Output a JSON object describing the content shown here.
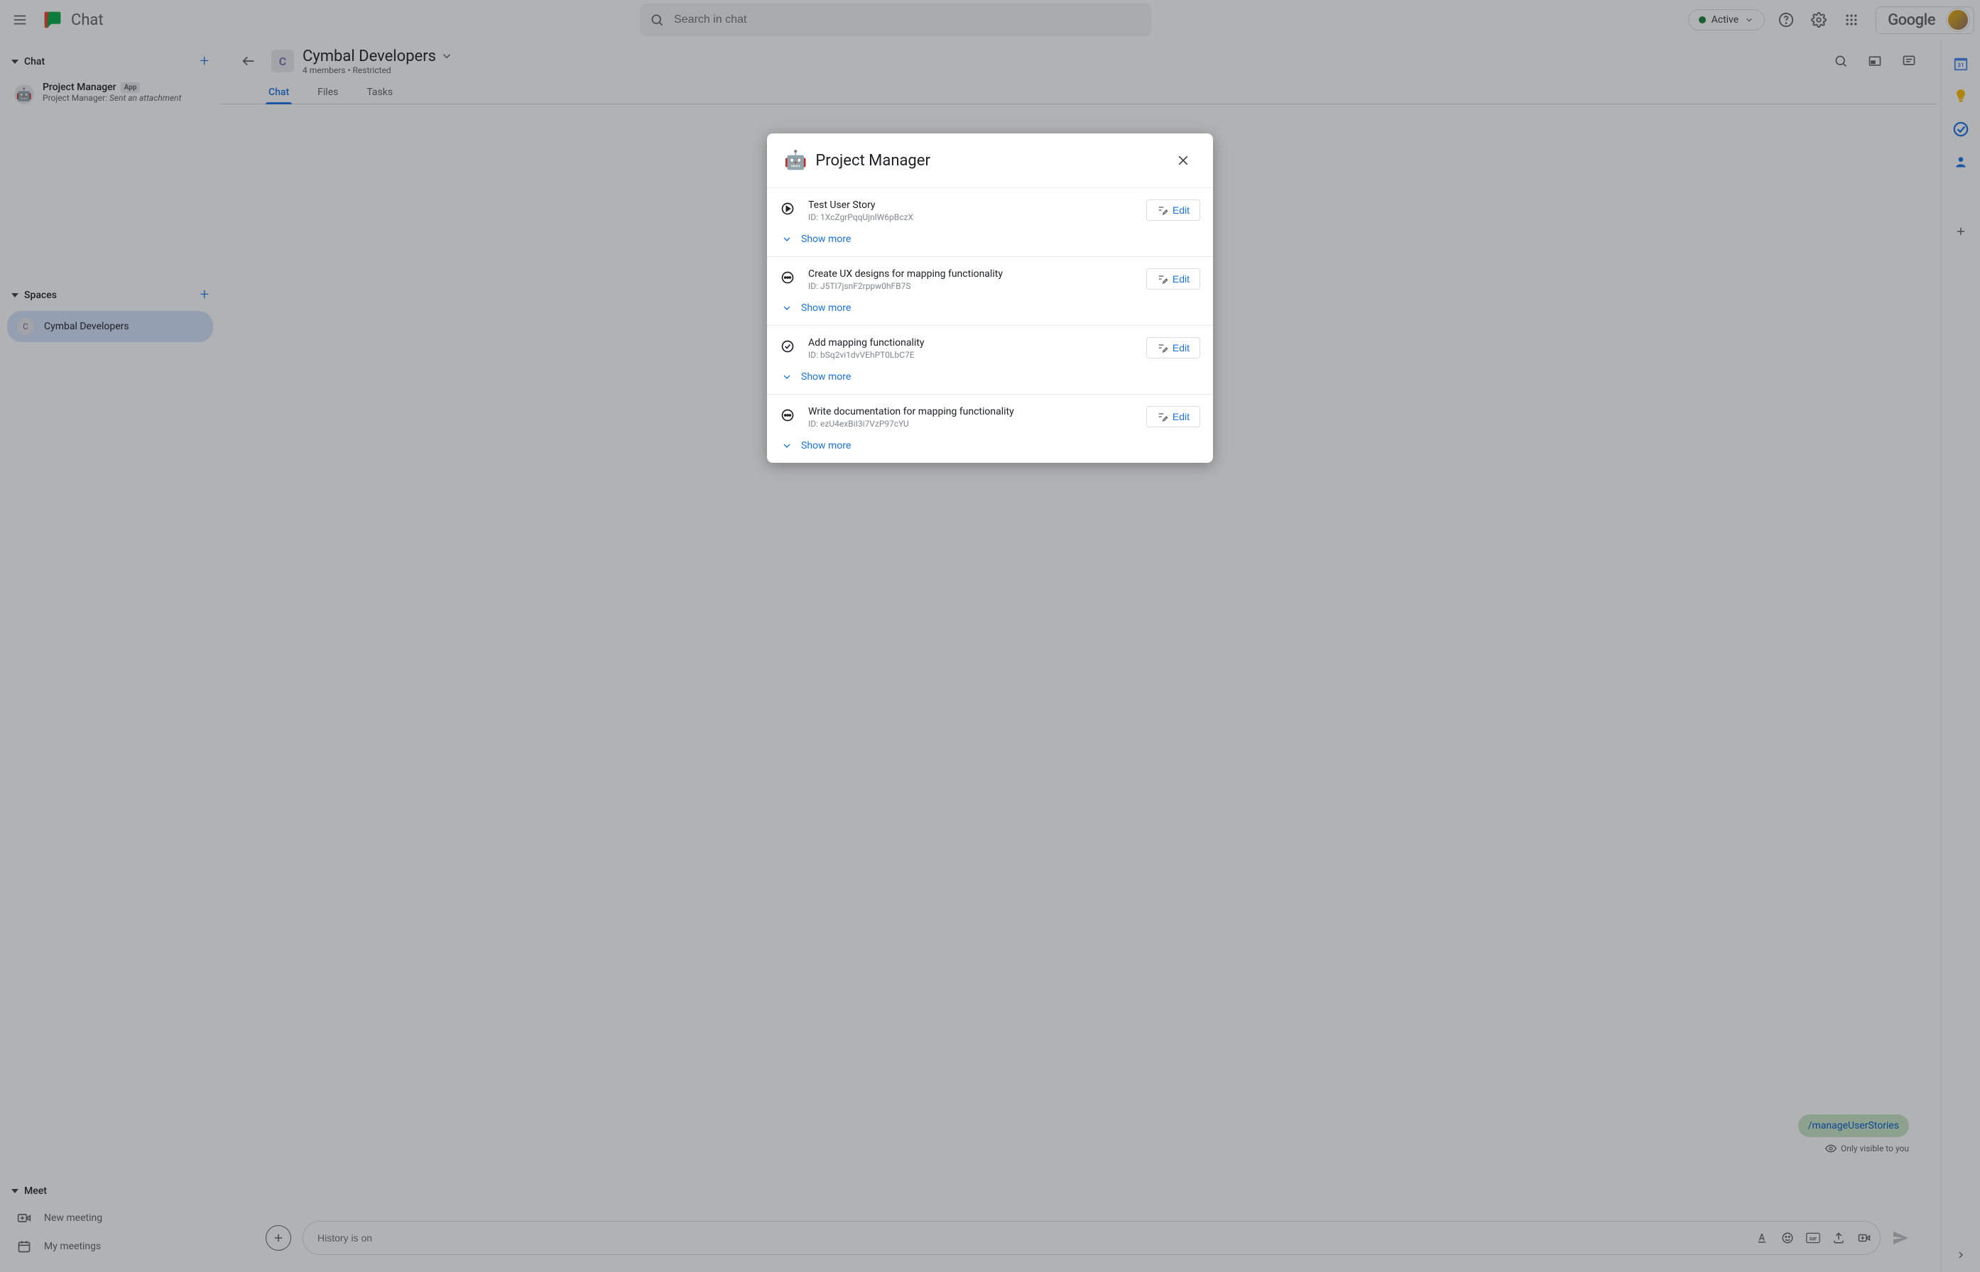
{
  "app": {
    "name": "Chat"
  },
  "topbar": {
    "search_placeholder": "Search in chat",
    "status": "Active",
    "brand": "Google"
  },
  "sidebar": {
    "sections": {
      "chat": {
        "label": "Chat"
      },
      "spaces": {
        "label": "Spaces"
      },
      "meet": {
        "label": "Meet"
      }
    },
    "chat_item": {
      "title": "Project Manager",
      "badge": "App",
      "subtitle_prefix": "Project Manager: ",
      "subtitle_italic": "Sent an attachment"
    },
    "space_item": {
      "initial": "C",
      "name": "Cymbal Developers"
    },
    "meet_new": "New meeting",
    "meet_my": "My meetings"
  },
  "space_header": {
    "initial": "C",
    "name": "Cymbal Developers",
    "meta": "4 members  •  Restricted",
    "tabs": [
      "Chat",
      "Files",
      "Tasks"
    ]
  },
  "messages": {
    "command": "/manageUserStories",
    "visible_note": "Only visible to you"
  },
  "composer": {
    "placeholder": "History is on"
  },
  "dialog": {
    "title": "Project Manager",
    "edit_label": "Edit",
    "show_more_label": "Show more",
    "stories": [
      {
        "icon": "play",
        "title": "Test User Story",
        "id": "ID: 1XcZgrPqqUjnlW6pBczX"
      },
      {
        "icon": "dots",
        "title": "Create UX designs for mapping functionality",
        "id": "ID: J5TI7jsnF2rppw0hFB7S"
      },
      {
        "icon": "check",
        "title": "Add mapping functionality",
        "id": "ID: bSq2vi1dvVEhPT0LbC7E"
      },
      {
        "icon": "dots",
        "title": "Write documentation for mapping functionality",
        "id": "ID: ezU4exBiI3i7VzP97cYU"
      }
    ]
  }
}
